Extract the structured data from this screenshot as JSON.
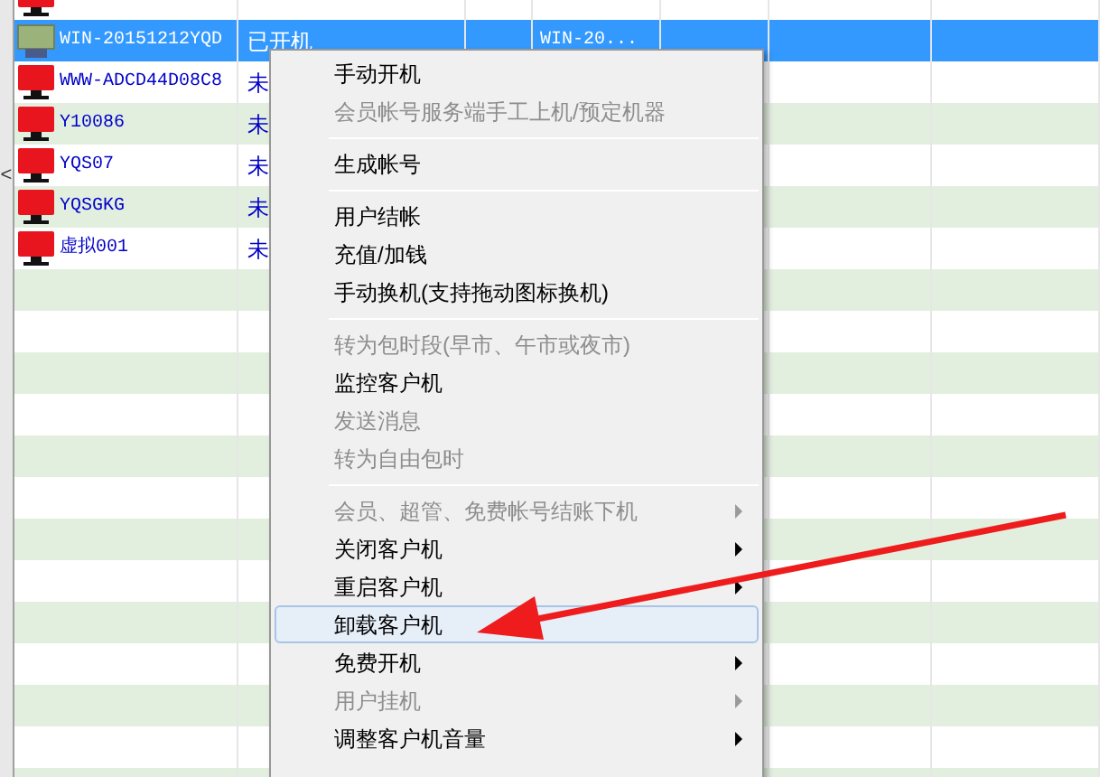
{
  "table": {
    "rows": [
      {
        "online": false,
        "selected": false
      },
      {
        "name": "WIN-20151212YQD",
        "status": "已开机",
        "column_4": "WIN-20...",
        "online": true,
        "selected": true
      },
      {
        "name": "WWW-ADCD44D08C8",
        "status": "未",
        "online": false,
        "selected": false
      },
      {
        "name": "Y10086",
        "status": "未",
        "online": false,
        "selected": false
      },
      {
        "name": "YQS07",
        "status": "未",
        "online": false,
        "selected": false
      },
      {
        "name": "YQSGKG",
        "status": "未",
        "online": false,
        "selected": false
      },
      {
        "name": "虚拟001",
        "status": "未",
        "online": false,
        "selected": false
      }
    ]
  },
  "scroll_left_glyph": "<",
  "context_menu": {
    "items": [
      {
        "kind": "item",
        "label": "手动开机",
        "disabled": false,
        "submenu": false,
        "selected": false
      },
      {
        "kind": "item",
        "label": "会员帐号服务端手工上机/预定机器",
        "disabled": true,
        "submenu": false,
        "selected": false
      },
      {
        "kind": "separator"
      },
      {
        "kind": "item",
        "label": "生成帐号",
        "disabled": false,
        "submenu": false,
        "selected": false
      },
      {
        "kind": "separator"
      },
      {
        "kind": "item",
        "label": "用户结帐",
        "disabled": false,
        "submenu": false,
        "selected": false
      },
      {
        "kind": "item",
        "label": "充值/加钱",
        "disabled": false,
        "submenu": false,
        "selected": false
      },
      {
        "kind": "item",
        "label": "手动换机(支持拖动图标换机)",
        "disabled": false,
        "submenu": false,
        "selected": false
      },
      {
        "kind": "separator"
      },
      {
        "kind": "item",
        "label": "转为包时段(早市、午市或夜市)",
        "disabled": true,
        "submenu": false,
        "selected": false
      },
      {
        "kind": "item",
        "label": "监控客户机",
        "disabled": false,
        "submenu": false,
        "selected": false
      },
      {
        "kind": "item",
        "label": "发送消息",
        "disabled": true,
        "submenu": false,
        "selected": false
      },
      {
        "kind": "item",
        "label": "转为自由包时",
        "disabled": true,
        "submenu": false,
        "selected": false
      },
      {
        "kind": "separator"
      },
      {
        "kind": "item",
        "label": "会员、超管、免费帐号结账下机",
        "disabled": true,
        "submenu": true,
        "selected": false
      },
      {
        "kind": "item",
        "label": "关闭客户机",
        "disabled": false,
        "submenu": true,
        "selected": false
      },
      {
        "kind": "item",
        "label": "重启客户机",
        "disabled": false,
        "submenu": true,
        "selected": false
      },
      {
        "kind": "item",
        "label": "卸载客户机",
        "disabled": false,
        "submenu": false,
        "selected": true
      },
      {
        "kind": "item",
        "label": "免费开机",
        "disabled": false,
        "submenu": true,
        "selected": false
      },
      {
        "kind": "item",
        "label": "用户挂机",
        "disabled": true,
        "submenu": true,
        "selected": false
      },
      {
        "kind": "item",
        "label": "调整客户机音量",
        "disabled": false,
        "submenu": true,
        "selected": false
      }
    ]
  }
}
